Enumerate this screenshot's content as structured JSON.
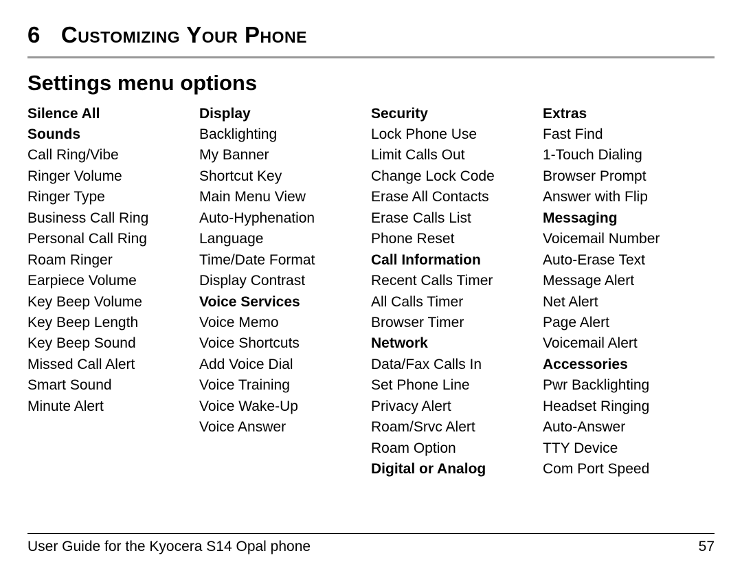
{
  "chapter": {
    "number": "6",
    "title": "Customizing Your Phone"
  },
  "section_title": "Settings menu options",
  "columns": [
    [
      {
        "text": "Silence All",
        "heading": true
      },
      {
        "text": "Sounds",
        "heading": true
      },
      {
        "text": "Call Ring/Vibe"
      },
      {
        "text": "Ringer Volume"
      },
      {
        "text": "Ringer Type"
      },
      {
        "text": "Business Call Ring"
      },
      {
        "text": "Personal Call Ring"
      },
      {
        "text": "Roam Ringer"
      },
      {
        "text": "Earpiece Volume"
      },
      {
        "text": "Key Beep Volume"
      },
      {
        "text": "Key Beep Length"
      },
      {
        "text": "Key Beep Sound"
      },
      {
        "text": "Missed Call Alert"
      },
      {
        "text": "Smart Sound"
      },
      {
        "text": "Minute Alert"
      }
    ],
    [
      {
        "text": "Display",
        "heading": true
      },
      {
        "text": "Backlighting"
      },
      {
        "text": "My Banner"
      },
      {
        "text": "Shortcut Key"
      },
      {
        "text": "Main Menu View"
      },
      {
        "text": "Auto-Hyphenation"
      },
      {
        "text": "Language"
      },
      {
        "text": "Time/Date Format"
      },
      {
        "text": "Display Contrast"
      },
      {
        "text": "Voice Services",
        "heading": true
      },
      {
        "text": "Voice Memo"
      },
      {
        "text": "Voice Shortcuts"
      },
      {
        "text": "Add Voice Dial"
      },
      {
        "text": "Voice Training"
      },
      {
        "text": "Voice Wake-Up"
      },
      {
        "text": "Voice Answer"
      }
    ],
    [
      {
        "text": "Security",
        "heading": true
      },
      {
        "text": "Lock Phone Use"
      },
      {
        "text": "Limit Calls Out"
      },
      {
        "text": "Change Lock Code"
      },
      {
        "text": "Erase All Contacts"
      },
      {
        "text": "Erase Calls List"
      },
      {
        "text": "Phone Reset"
      },
      {
        "text": "Call Information",
        "heading": true
      },
      {
        "text": "Recent Calls Timer"
      },
      {
        "text": "All Calls Timer"
      },
      {
        "text": "Browser Timer"
      },
      {
        "text": "Network",
        "heading": true
      },
      {
        "text": "Data/Fax Calls In"
      },
      {
        "text": "Set Phone Line"
      },
      {
        "text": "Privacy Alert"
      },
      {
        "text": "Roam/Srvc Alert"
      },
      {
        "text": "Roam Option"
      },
      {
        "text": "Digital or Analog",
        "heading": true
      }
    ],
    [
      {
        "text": "Extras",
        "heading": true
      },
      {
        "text": "Fast Find"
      },
      {
        "text": "1-Touch Dialing"
      },
      {
        "text": "Browser Prompt"
      },
      {
        "text": "Answer with Flip"
      },
      {
        "text": "Messaging",
        "heading": true
      },
      {
        "text": "Voicemail Number"
      },
      {
        "text": "Auto-Erase Text"
      },
      {
        "text": "Message Alert"
      },
      {
        "text": "Net Alert"
      },
      {
        "text": "Page Alert"
      },
      {
        "text": "Voicemail Alert"
      },
      {
        "text": "Accessories",
        "heading": true
      },
      {
        "text": "Pwr Backlighting"
      },
      {
        "text": "Headset Ringing"
      },
      {
        "text": "Auto-Answer"
      },
      {
        "text": "TTY Device"
      },
      {
        "text": "Com Port Speed"
      }
    ]
  ],
  "footer": {
    "left": "User Guide for the Kyocera S14 Opal phone",
    "right": "57"
  }
}
